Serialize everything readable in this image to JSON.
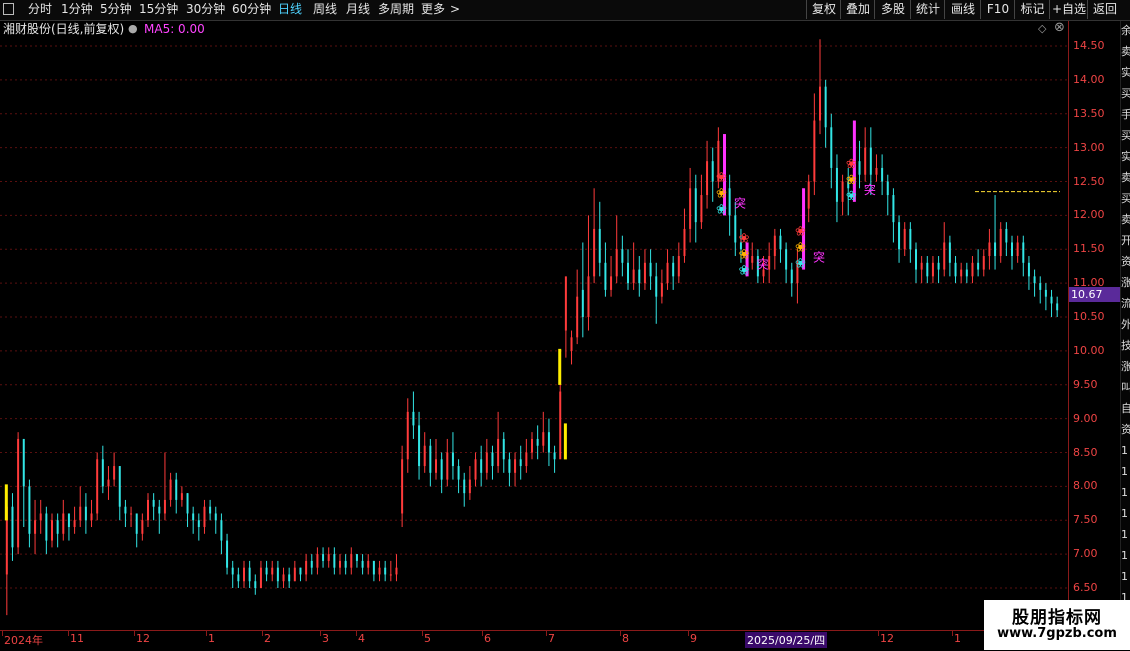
{
  "toolbar": {
    "periods": [
      "分时",
      "1分钟",
      "5分钟",
      "15分钟",
      "30分钟",
      "60分钟",
      "日线",
      "周线",
      "月线",
      "多周期",
      "更多"
    ],
    "active_period": "日线",
    "more_arrow": ">",
    "right_buttons": [
      "复权",
      "叠加",
      "多股",
      "统计",
      "画线",
      "F10",
      "标记",
      "+自选",
      "返回"
    ]
  },
  "title": {
    "stock": "湘财股份(日线,前复权)",
    "indicator": "MA5: 0.00"
  },
  "y_axis": {
    "labels": [
      "14.50",
      "14.00",
      "13.50",
      "13.00",
      "12.50",
      "12.00",
      "11.50",
      "11.00",
      "10.50",
      "10.00",
      "9.50",
      "9.00",
      "8.50",
      "8.00",
      "7.50",
      "7.00",
      "6.50"
    ],
    "current_price": "10.67"
  },
  "x_axis": {
    "labels": [
      "2024年",
      "11",
      "12",
      "1",
      "2",
      "3",
      "4",
      "5",
      "6",
      "7",
      "8",
      "9",
      "2025/09/25/四",
      "12",
      "1"
    ]
  },
  "signal_label": "突",
  "watermark": {
    "line1": "股朋指标网",
    "line2": "www.7gpzb.com"
  },
  "right_strip_chars": [
    "余",
    "卖",
    "实",
    "买",
    "手",
    "买",
    "实",
    "卖",
    "买",
    "卖",
    "开",
    "资",
    "涨",
    "流",
    "外",
    "技",
    "涨",
    "叫",
    "自",
    "资",
    "1",
    "1",
    "1",
    "1",
    "1",
    "1",
    "1",
    "1"
  ],
  "colors": {
    "up": "#ff3b3b",
    "down": "#32e6e6",
    "grid": "#5a0f0f",
    "magenta": "#ff33ff",
    "yellow": "#ffee00"
  },
  "chart_data": {
    "type": "candlestick",
    "ylim": [
      6.3,
      14.7
    ],
    "resistance_line": 12.35,
    "candles": [
      [
        6.7,
        7.7,
        6.1,
        8.0
      ],
      [
        7.7,
        7.1,
        6.9,
        7.9
      ],
      [
        7.1,
        8.7,
        7.0,
        8.8
      ],
      [
        8.7,
        8.0,
        7.4,
        8.7
      ],
      [
        8.0,
        7.3,
        7.1,
        8.1
      ],
      [
        7.3,
        7.5,
        7.0,
        7.8
      ],
      [
        7.5,
        7.6,
        7.3,
        7.8
      ],
      [
        7.6,
        7.2,
        7.0,
        7.7
      ],
      [
        7.2,
        7.5,
        7.1,
        7.6
      ],
      [
        7.5,
        7.3,
        7.1,
        7.6
      ],
      [
        7.3,
        7.6,
        7.2,
        7.8
      ],
      [
        7.6,
        7.4,
        7.2,
        7.6
      ],
      [
        7.4,
        7.5,
        7.3,
        7.7
      ],
      [
        7.5,
        7.7,
        7.4,
        8.0
      ],
      [
        7.7,
        7.5,
        7.3,
        7.9
      ],
      [
        7.5,
        7.6,
        7.4,
        7.8
      ],
      [
        7.6,
        8.4,
        7.5,
        8.5
      ],
      [
        8.4,
        8.0,
        7.9,
        8.6
      ],
      [
        8.0,
        8.1,
        7.8,
        8.3
      ],
      [
        8.1,
        8.3,
        8.0,
        8.5
      ],
      [
        8.3,
        7.7,
        7.5,
        8.3
      ],
      [
        7.7,
        7.6,
        7.4,
        7.8
      ],
      [
        7.6,
        7.6,
        7.4,
        7.7
      ],
      [
        7.6,
        7.3,
        7.1,
        7.6
      ],
      [
        7.3,
        7.5,
        7.2,
        7.6
      ],
      [
        7.5,
        7.8,
        7.4,
        7.9
      ],
      [
        7.8,
        7.7,
        7.5,
        7.9
      ],
      [
        7.7,
        7.6,
        7.3,
        7.8
      ],
      [
        7.6,
        7.8,
        7.5,
        8.5
      ],
      [
        7.8,
        8.1,
        7.7,
        8.2
      ],
      [
        8.1,
        7.8,
        7.6,
        8.2
      ],
      [
        7.8,
        7.9,
        7.7,
        8.0
      ],
      [
        7.9,
        7.6,
        7.4,
        7.9
      ],
      [
        7.6,
        7.5,
        7.3,
        7.7
      ],
      [
        7.5,
        7.4,
        7.2,
        7.6
      ],
      [
        7.4,
        7.7,
        7.3,
        7.8
      ],
      [
        7.7,
        7.6,
        7.5,
        7.8
      ],
      [
        7.6,
        7.5,
        7.3,
        7.7
      ],
      [
        7.5,
        7.2,
        7.0,
        7.6
      ],
      [
        7.2,
        6.8,
        6.7,
        7.3
      ],
      [
        6.8,
        6.7,
        6.5,
        6.9
      ],
      [
        6.7,
        6.6,
        6.5,
        6.8
      ],
      [
        6.6,
        6.8,
        6.5,
        6.9
      ],
      [
        6.8,
        6.6,
        6.5,
        6.9
      ],
      [
        6.6,
        6.5,
        6.4,
        6.7
      ],
      [
        6.5,
        6.8,
        6.5,
        6.9
      ],
      [
        6.8,
        6.7,
        6.6,
        6.9
      ],
      [
        6.7,
        6.8,
        6.6,
        6.9
      ],
      [
        6.8,
        6.6,
        6.5,
        6.9
      ],
      [
        6.6,
        6.7,
        6.5,
        6.8
      ],
      [
        6.7,
        6.6,
        6.5,
        6.8
      ],
      [
        6.6,
        6.8,
        6.6,
        6.9
      ],
      [
        6.8,
        6.7,
        6.6,
        6.8
      ],
      [
        6.7,
        6.9,
        6.6,
        7.0
      ],
      [
        6.9,
        6.8,
        6.7,
        7.0
      ],
      [
        6.8,
        7.0,
        6.7,
        7.1
      ],
      [
        7.0,
        6.9,
        6.8,
        7.1
      ],
      [
        6.9,
        7.0,
        6.8,
        7.1
      ],
      [
        7.0,
        6.8,
        6.7,
        7.1
      ],
      [
        6.8,
        6.9,
        6.7,
        7.0
      ],
      [
        6.9,
        6.8,
        6.7,
        7.0
      ],
      [
        6.8,
        7.0,
        6.7,
        7.1
      ],
      [
        7.0,
        6.9,
        6.8,
        7.0
      ],
      [
        6.9,
        6.8,
        6.7,
        7.0
      ],
      [
        6.8,
        6.9,
        6.7,
        7.0
      ],
      [
        6.9,
        6.7,
        6.6,
        6.9
      ],
      [
        6.7,
        6.8,
        6.6,
        6.9
      ],
      [
        6.8,
        6.7,
        6.6,
        6.9
      ],
      [
        6.7,
        6.7,
        6.6,
        6.9
      ],
      [
        6.7,
        6.8,
        6.6,
        7.0
      ],
      [
        7.6,
        8.4,
        7.4,
        8.6
      ],
      [
        8.4,
        9.1,
        8.2,
        9.3
      ],
      [
        9.1,
        8.9,
        8.7,
        9.4
      ],
      [
        8.9,
        8.3,
        8.1,
        9.1
      ],
      [
        8.3,
        8.6,
        8.2,
        8.8
      ],
      [
        8.6,
        8.2,
        8.0,
        8.7
      ],
      [
        8.2,
        8.4,
        8.1,
        8.7
      ],
      [
        8.4,
        8.1,
        7.9,
        8.5
      ],
      [
        8.1,
        8.5,
        8.0,
        8.7
      ],
      [
        8.5,
        8.3,
        8.1,
        8.8
      ],
      [
        8.3,
        8.1,
        7.9,
        8.4
      ],
      [
        8.1,
        7.9,
        7.7,
        8.2
      ],
      [
        7.9,
        8.1,
        7.8,
        8.3
      ],
      [
        8.1,
        8.4,
        8.0,
        8.5
      ],
      [
        8.4,
        8.2,
        8.0,
        8.6
      ],
      [
        8.2,
        8.5,
        8.1,
        8.7
      ],
      [
        8.5,
        8.3,
        8.1,
        8.6
      ],
      [
        8.3,
        8.7,
        8.2,
        9.1
      ],
      [
        8.7,
        8.4,
        8.2,
        8.8
      ],
      [
        8.4,
        8.2,
        8.0,
        8.5
      ],
      [
        8.2,
        8.4,
        8.0,
        8.5
      ],
      [
        8.4,
        8.3,
        8.1,
        8.6
      ],
      [
        8.3,
        8.5,
        8.2,
        8.7
      ],
      [
        8.5,
        8.7,
        8.4,
        8.8
      ],
      [
        8.7,
        8.6,
        8.4,
        8.9
      ],
      [
        8.6,
        8.8,
        8.5,
        9.1
      ],
      [
        8.8,
        8.5,
        8.3,
        9.0
      ],
      [
        8.5,
        8.4,
        8.2,
        8.6
      ],
      [
        8.4,
        9.4,
        8.9,
        10.0
      ],
      [
        10.3,
        11.1,
        9.9,
        11.0
      ],
      [
        10.0,
        10.2,
        9.8,
        10.3
      ],
      [
        10.2,
        10.8,
        10.1,
        11.2
      ],
      [
        10.9,
        10.5,
        10.2,
        11.6
      ],
      [
        10.5,
        11.1,
        10.3,
        12.0
      ],
      [
        11.1,
        11.8,
        11.0,
        12.4
      ],
      [
        11.8,
        11.3,
        11.1,
        12.2
      ],
      [
        11.3,
        10.9,
        10.8,
        11.6
      ],
      [
        10.9,
        11.1,
        10.8,
        11.4
      ],
      [
        11.1,
        11.5,
        11.0,
        12.0
      ],
      [
        11.5,
        11.3,
        11.1,
        11.7
      ],
      [
        11.3,
        11.0,
        10.9,
        11.5
      ],
      [
        11.0,
        11.2,
        10.9,
        11.6
      ],
      [
        11.2,
        11.0,
        10.8,
        11.4
      ],
      [
        11.0,
        11.3,
        10.9,
        11.5
      ],
      [
        11.3,
        11.1,
        10.9,
        11.5
      ],
      [
        11.1,
        10.8,
        10.4,
        11.3
      ],
      [
        10.8,
        11.0,
        10.7,
        11.2
      ],
      [
        11.0,
        11.3,
        10.9,
        11.5
      ],
      [
        11.3,
        11.1,
        10.9,
        11.4
      ],
      [
        11.1,
        11.4,
        11.0,
        11.6
      ],
      [
        11.4,
        11.8,
        11.3,
        12.1
      ],
      [
        11.8,
        12.4,
        11.6,
        12.7
      ],
      [
        12.4,
        11.9,
        11.6,
        12.6
      ],
      [
        11.9,
        12.3,
        11.8,
        12.6
      ],
      [
        12.3,
        12.8,
        12.1,
        13.1
      ],
      [
        12.8,
        12.5,
        12.2,
        13.0
      ],
      [
        12.5,
        13.1,
        12.4,
        13.3
      ],
      [
        13.1,
        12.4,
        12.0,
        13.2
      ],
      [
        12.4,
        12.0,
        11.7,
        12.6
      ],
      [
        12.0,
        11.6,
        11.4,
        12.2
      ],
      [
        11.6,
        11.5,
        11.3,
        11.8
      ],
      [
        11.5,
        11.3,
        11.1,
        11.6
      ],
      [
        11.3,
        11.4,
        11.2,
        11.6
      ],
      [
        11.4,
        11.1,
        11.0,
        11.5
      ],
      [
        11.1,
        11.2,
        11.0,
        11.4
      ],
      [
        11.2,
        11.4,
        11.0,
        11.6
      ],
      [
        11.4,
        11.7,
        11.2,
        11.8
      ],
      [
        11.7,
        11.5,
        11.3,
        11.8
      ],
      [
        11.5,
        11.2,
        11.0,
        11.6
      ],
      [
        11.2,
        11.0,
        10.8,
        11.3
      ],
      [
        11.0,
        11.3,
        10.7,
        11.5
      ],
      [
        11.3,
        12.1,
        11.2,
        12.4
      ],
      [
        12.1,
        12.5,
        11.9,
        12.6
      ],
      [
        12.5,
        13.4,
        12.3,
        13.8
      ],
      [
        13.4,
        13.9,
        13.2,
        14.6
      ],
      [
        13.9,
        13.3,
        13.0,
        14.0
      ],
      [
        13.3,
        12.7,
        12.4,
        13.5
      ],
      [
        12.7,
        12.2,
        11.9,
        12.9
      ],
      [
        12.2,
        12.5,
        12.0,
        12.6
      ],
      [
        12.5,
        12.4,
        12.0,
        12.7
      ],
      [
        12.4,
        12.8,
        12.2,
        13.4
      ],
      [
        12.8,
        12.6,
        12.4,
        13.1
      ],
      [
        12.6,
        13.0,
        12.5,
        13.3
      ],
      [
        13.0,
        12.6,
        12.3,
        13.3
      ],
      [
        12.6,
        12.7,
        12.5,
        12.9
      ],
      [
        12.7,
        12.5,
        12.3,
        12.9
      ],
      [
        12.5,
        12.3,
        12.0,
        12.6
      ],
      [
        12.3,
        11.9,
        11.6,
        12.4
      ],
      [
        11.9,
        11.5,
        11.3,
        12.0
      ],
      [
        11.5,
        11.8,
        11.4,
        11.9
      ],
      [
        11.8,
        11.5,
        11.3,
        11.9
      ],
      [
        11.5,
        11.2,
        11.0,
        11.6
      ],
      [
        11.2,
        11.3,
        11.0,
        11.4
      ],
      [
        11.3,
        11.1,
        11.0,
        11.4
      ],
      [
        11.1,
        11.3,
        11.0,
        11.4
      ],
      [
        11.3,
        11.2,
        11.0,
        11.4
      ],
      [
        11.2,
        11.6,
        11.1,
        11.9
      ],
      [
        11.6,
        11.3,
        11.1,
        11.7
      ],
      [
        11.3,
        11.1,
        11.0,
        11.4
      ],
      [
        11.1,
        11.2,
        11.0,
        11.3
      ],
      [
        11.2,
        11.1,
        11.0,
        11.3
      ],
      [
        11.1,
        11.3,
        11.0,
        11.4
      ],
      [
        11.3,
        11.2,
        11.1,
        11.5
      ],
      [
        11.2,
        11.4,
        11.1,
        11.5
      ],
      [
        11.4,
        11.6,
        11.2,
        11.8
      ],
      [
        11.6,
        11.4,
        11.2,
        12.3
      ],
      [
        11.4,
        11.8,
        11.3,
        11.9
      ],
      [
        11.8,
        11.6,
        11.4,
        11.9
      ],
      [
        11.6,
        11.4,
        11.2,
        11.7
      ],
      [
        11.4,
        11.6,
        11.3,
        11.7
      ],
      [
        11.6,
        11.3,
        11.1,
        11.7
      ],
      [
        11.3,
        11.1,
        10.9,
        11.4
      ],
      [
        11.1,
        11.0,
        10.8,
        11.2
      ],
      [
        11.0,
        10.9,
        10.7,
        11.1
      ],
      [
        10.9,
        10.8,
        10.6,
        11.0
      ],
      [
        10.8,
        10.7,
        10.5,
        10.9
      ],
      [
        10.7,
        10.6,
        10.5,
        10.8
      ]
    ],
    "markers": [
      {
        "i": 98,
        "y": 10.0,
        "color": "yellow"
      },
      {
        "i": 99,
        "y": 8.9,
        "color": "yellow"
      },
      {
        "i": 0,
        "y": 8.0,
        "color": "yellow"
      }
    ],
    "signals": [
      127,
      131,
      141,
      150
    ]
  }
}
